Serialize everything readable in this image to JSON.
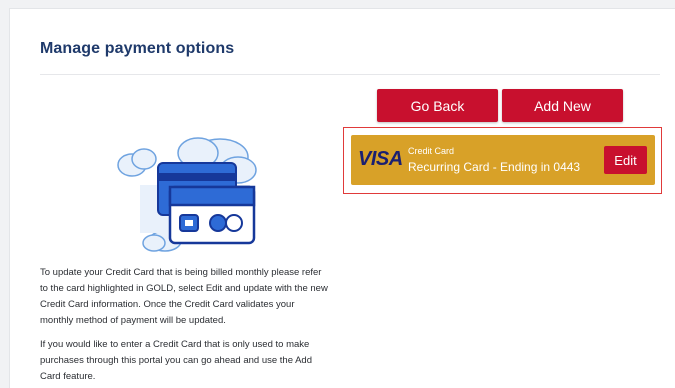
{
  "page": {
    "title": "Manage payment options"
  },
  "actions": {
    "go_back_label": "Go Back",
    "add_new_label": "Add New"
  },
  "card": {
    "brand": "VISA",
    "type": "Credit Card",
    "description": "Recurring Card - Ending in 0443",
    "edit_label": "Edit",
    "highlight_color": "#d8a128"
  },
  "instructions": {
    "update_text": "To update your Credit Card that is being billed monthly please refer to the card highlighted in GOLD, select Edit and update with the new Credit Card information. Once the Credit Card validates your monthly method of payment will be updated.",
    "add_text": "If you would like to enter a Credit Card that is only used to make purchases through this portal you can go ahead and use the Add Card feature."
  },
  "illustration": {
    "icon": "credit-card-illustration-icon"
  },
  "colors": {
    "brand_red": "#c8102e",
    "title_blue": "#1f3a6b",
    "visa_blue": "#1a1f71",
    "frame_red": "#e03a3a"
  }
}
